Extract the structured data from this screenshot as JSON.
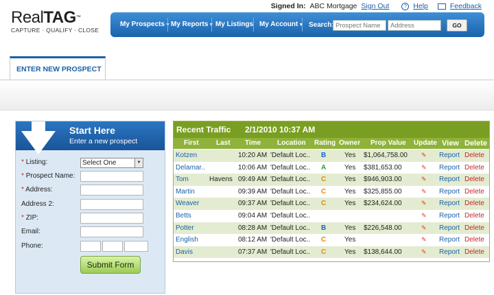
{
  "header": {
    "logo_real": "Real",
    "logo_tag": "TAG",
    "logo_tm": "™",
    "logo_tagline": "CAPTURE · QUALIFY · CLOSE",
    "signed_in_label": "Signed In:",
    "signed_in_value": "ABC Mortgage",
    "sign_out": "Sign Out",
    "help": "Help",
    "feedback": "Feedback"
  },
  "nav": {
    "items": [
      "My Prospects",
      "My Reports",
      "My Listings",
      "My Account"
    ],
    "search_label": "Search:",
    "search_prospect_placeholder": "Prospect Name",
    "search_address_placeholder": "Address",
    "go": "GO"
  },
  "tab": {
    "label": "ENTER NEW PROSPECT"
  },
  "form": {
    "title": "Start Here",
    "subtitle": "Enter a new prospect",
    "required_mark": "*",
    "fields": {
      "listing": "Listing:",
      "prospect_name": "Prospect Name:",
      "address": "Address:",
      "address2": "Address 2:",
      "zip": "ZIP:",
      "email": "Email:",
      "phone": "Phone:"
    },
    "listing_selected": "Select One",
    "submit": "Submit Form"
  },
  "traffic": {
    "title": "Recent Traffic",
    "datetime": "2/1/2010 10:37 AM",
    "columns": {
      "first": "First",
      "last": "Last",
      "time": "Time",
      "location": "Location",
      "rating": "Rating",
      "owner": "Owner",
      "prop_value": "Prop Value",
      "update": "Update",
      "view": "View",
      "delete": "Delete"
    },
    "rows": [
      {
        "first": "Kotzen",
        "last": "",
        "time": "10:20 AM",
        "location": "'Default Loc..",
        "rating": "B",
        "owner": "Yes",
        "prop_value": "$1,064,758.00",
        "view": "Report",
        "delete": "Delete"
      },
      {
        "first": "Delamar..",
        "last": "",
        "time": "10:06 AM",
        "location": "'Default Loc..",
        "rating": "A",
        "owner": "Yes",
        "prop_value": "$381,653.00",
        "view": "Report",
        "delete": "Delete"
      },
      {
        "first": "Tom",
        "last": "Havens",
        "time": "09:49 AM",
        "location": "'Default Loc..",
        "rating": "C",
        "owner": "Yes",
        "prop_value": "$946,903.00",
        "view": "Report",
        "delete": "Delete"
      },
      {
        "first": "Martin",
        "last": "",
        "time": "09:39 AM",
        "location": "'Default Loc..",
        "rating": "C",
        "owner": "Yes",
        "prop_value": "$325,855.00",
        "view": "Report",
        "delete": "Delete"
      },
      {
        "first": "Weaver",
        "last": "",
        "time": "09:37 AM",
        "location": "'Default Loc..",
        "rating": "C",
        "owner": "Yes",
        "prop_value": "$234,624.00",
        "view": "Report",
        "delete": "Delete"
      },
      {
        "first": "Betts",
        "last": "",
        "time": "09:04 AM",
        "location": "'Default Loc..",
        "rating": "",
        "owner": "",
        "prop_value": "",
        "view": "Report",
        "delete": "Delete"
      },
      {
        "first": "Potter",
        "last": "",
        "time": "08:28 AM",
        "location": "'Default Loc..",
        "rating": "B",
        "owner": "Yes",
        "prop_value": "$226,548.00",
        "view": "Report",
        "delete": "Delete"
      },
      {
        "first": "English",
        "last": "",
        "time": "08:12 AM",
        "location": "'Default Loc..",
        "rating": "C",
        "owner": "Yes",
        "prop_value": "",
        "view": "Report",
        "delete": "Delete"
      },
      {
        "first": "Davis",
        "last": "",
        "time": "07:37 AM",
        "location": "'Default Loc..",
        "rating": "C",
        "owner": "Yes",
        "prop_value": "$138,644.00",
        "view": "Report",
        "delete": "Delete"
      }
    ]
  },
  "colors": {
    "brand_blue": "#1b62ad",
    "traffic_green": "#7a9e22",
    "rating_A": "#2ea02e",
    "rating_B": "#1a5fd0",
    "rating_C": "#e08a10",
    "delete_red": "#c0282c"
  },
  "icons": {
    "update": "pencil-edit-icon",
    "help": "help-icon",
    "feedback": "mail-icon",
    "form_arrow": "down-arrow-icon"
  }
}
